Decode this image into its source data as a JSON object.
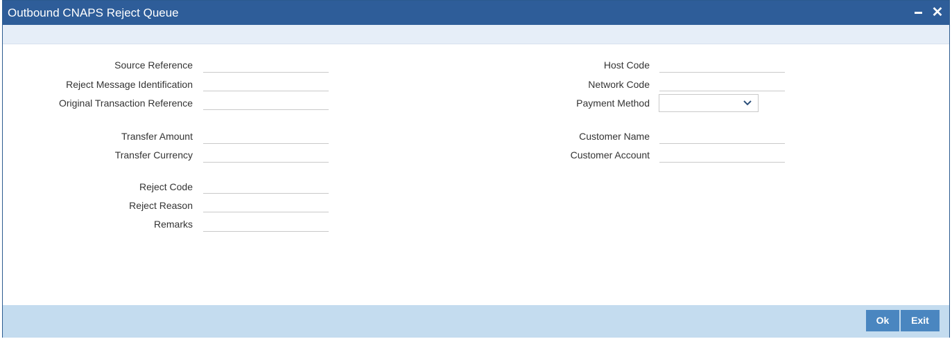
{
  "window": {
    "title": "Outbound CNAPS Reject Queue",
    "minimize_icon": "minimize-icon",
    "close_icon": "close-icon"
  },
  "form": {
    "left": {
      "source_reference": {
        "label": "Source Reference",
        "value": ""
      },
      "reject_message_identification": {
        "label": "Reject Message Identification",
        "value": ""
      },
      "original_transaction_reference": {
        "label": "Original Transaction Reference",
        "value": ""
      },
      "transfer_amount": {
        "label": "Transfer Amount",
        "value": ""
      },
      "transfer_currency": {
        "label": "Transfer Currency",
        "value": ""
      },
      "reject_code": {
        "label": "Reject Code",
        "value": ""
      },
      "reject_reason": {
        "label": "Reject Reason",
        "value": ""
      },
      "remarks": {
        "label": "Remarks",
        "value": ""
      }
    },
    "right": {
      "host_code": {
        "label": "Host Code",
        "value": ""
      },
      "network_code": {
        "label": "Network Code",
        "value": ""
      },
      "payment_method": {
        "label": "Payment Method",
        "value": "",
        "icon": "chevron-down-icon"
      },
      "customer_name": {
        "label": "Customer Name",
        "value": ""
      },
      "customer_account": {
        "label": "Customer Account",
        "value": ""
      }
    }
  },
  "footer": {
    "ok_label": "Ok",
    "exit_label": "Exit"
  },
  "colors": {
    "titlebar": "#2e5d99",
    "footer": "#c4dcef",
    "button": "#4a86c0"
  }
}
